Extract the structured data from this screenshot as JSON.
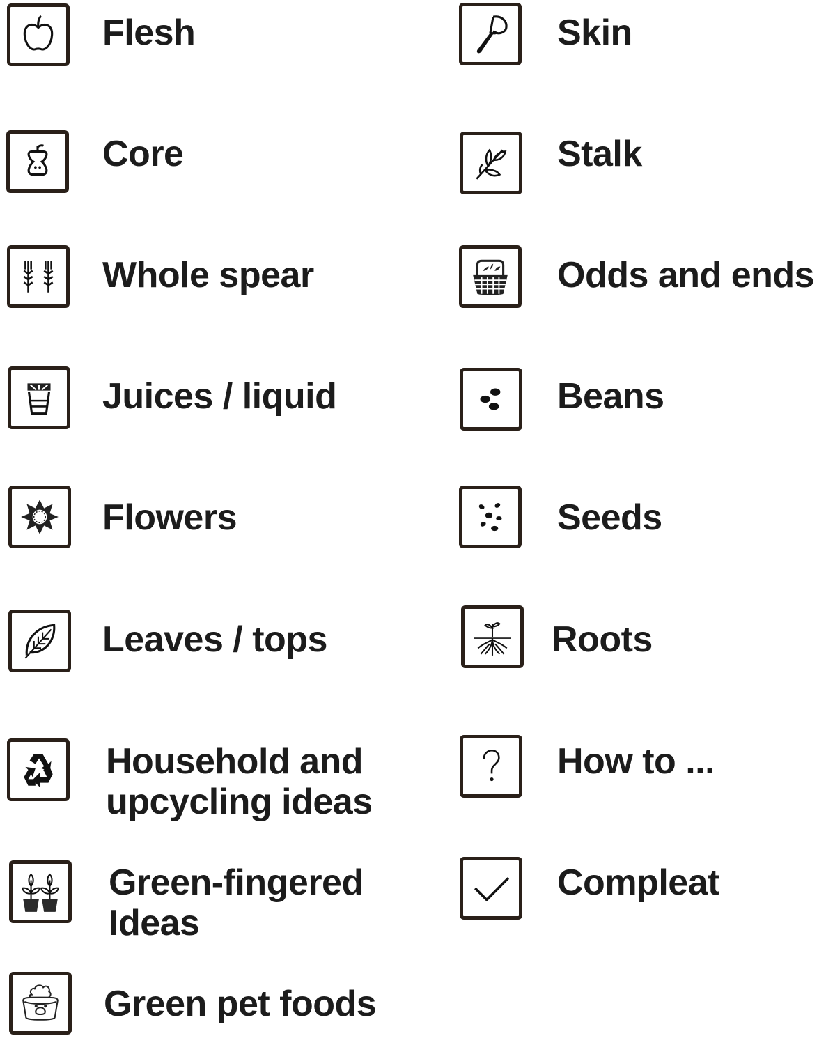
{
  "legend": {
    "left": [
      {
        "label": "Flesh",
        "icon": "apple-icon"
      },
      {
        "label": "Core",
        "icon": "apple-core-icon"
      },
      {
        "label": "Whole spear",
        "icon": "wheat-icon"
      },
      {
        "label": "Juices / liquid",
        "icon": "juice-glass-icon"
      },
      {
        "label": "Flowers",
        "icon": "flower-icon"
      },
      {
        "label": "Leaves / tops",
        "icon": "leaf-icon"
      },
      {
        "label_line1": "Household and",
        "label_line2": "upcycling ideas",
        "icon": "recycle-icon"
      },
      {
        "label_line1": "Green-fingered",
        "label_line2": "Ideas",
        "icon": "potted-plants-icon"
      },
      {
        "label": "Green pet foods",
        "icon": "pet-bowl-icon"
      }
    ],
    "right": [
      {
        "label": "Skin",
        "icon": "peeler-icon"
      },
      {
        "label": "Stalk",
        "icon": "stalk-icon"
      },
      {
        "label": "Odds and ends",
        "icon": "basket-icon"
      },
      {
        "label": "Beans",
        "icon": "beans-icon"
      },
      {
        "label": "Seeds",
        "icon": "seeds-icon"
      },
      {
        "label": "Roots",
        "icon": "roots-icon"
      },
      {
        "label": "How to ...",
        "icon": "question-mark-icon"
      },
      {
        "label": "Compleat",
        "icon": "checkmark-icon"
      }
    ]
  }
}
